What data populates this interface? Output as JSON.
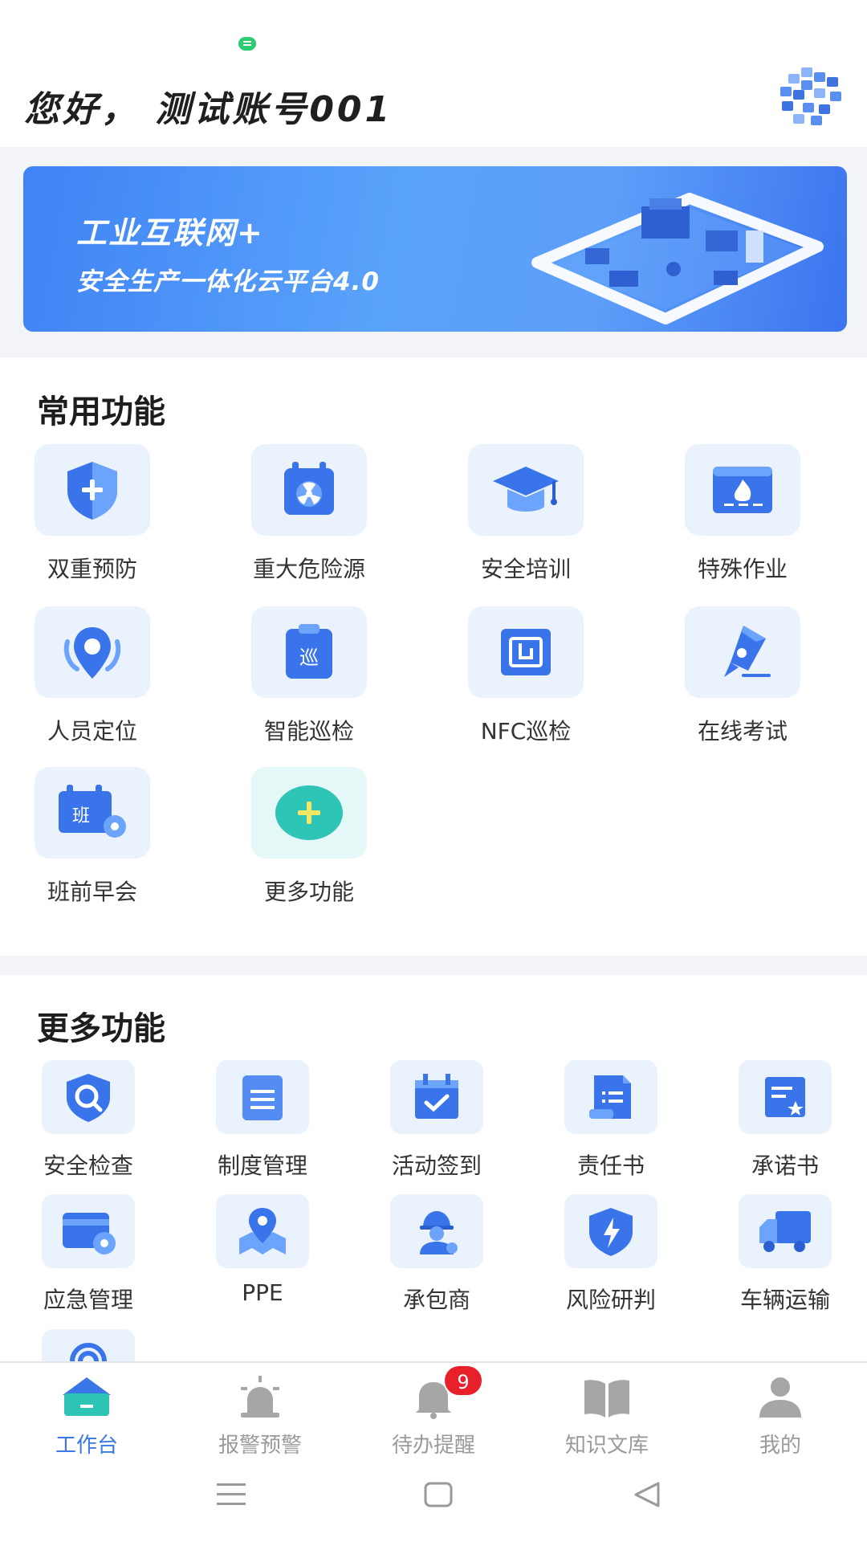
{
  "header": {
    "greeting": "您好， 测试账号001"
  },
  "banner": {
    "line1": "工业互联网+",
    "line2": "安全生产一体化云平台4.0"
  },
  "common_section": {
    "title": "常用功能",
    "items": [
      {
        "label": "双重预防",
        "icon": "shield-plus-icon"
      },
      {
        "label": "重大危险源",
        "icon": "radiation-calendar-icon"
      },
      {
        "label": "安全培训",
        "icon": "graduation-cap-icon"
      },
      {
        "label": "特殊作业",
        "icon": "fire-monitor-icon"
      },
      {
        "label": "人员定位",
        "icon": "location-pin-icon"
      },
      {
        "label": "智能巡检",
        "icon": "patrol-clipboard-icon",
        "glyph": "巡"
      },
      {
        "label": "NFC巡检",
        "icon": "nfc-icon"
      },
      {
        "label": "在线考试",
        "icon": "pen-nib-icon"
      },
      {
        "label": "班前早会",
        "icon": "shift-calendar-gear-icon",
        "glyph": "班"
      },
      {
        "label": "更多功能",
        "icon": "plus-circle-icon"
      }
    ]
  },
  "more_section": {
    "title": "更多功能",
    "items": [
      {
        "label": "安全检查",
        "icon": "shield-search-icon"
      },
      {
        "label": "制度管理",
        "icon": "document-icon"
      },
      {
        "label": "活动签到",
        "icon": "calendar-check-icon"
      },
      {
        "label": "责任书",
        "icon": "scroll-icon"
      },
      {
        "label": "承诺书",
        "icon": "certificate-icon"
      },
      {
        "label": "应急管理",
        "icon": "card-gear-icon"
      },
      {
        "label": "PPE",
        "icon": "map-pin-icon"
      },
      {
        "label": "承包商",
        "icon": "worker-helmet-icon"
      },
      {
        "label": "风险研判",
        "icon": "shield-lightning-icon"
      },
      {
        "label": "车辆运输",
        "icon": "truck-icon"
      },
      {
        "label": "",
        "icon": "signal-icon"
      }
    ]
  },
  "bottom_nav": {
    "items": [
      {
        "label": "工作台",
        "icon": "workbench-icon",
        "active": true
      },
      {
        "label": "报警预警",
        "icon": "alarm-light-icon"
      },
      {
        "label": "待办提醒",
        "icon": "bell-icon",
        "badge": "9"
      },
      {
        "label": "知识文库",
        "icon": "book-icon"
      },
      {
        "label": "我的",
        "icon": "user-icon"
      }
    ]
  },
  "colors": {
    "accent": "#3b78e7",
    "icon_bg": "#eaf2fd",
    "badge": "#e8202a",
    "banner": "#4a8ff7"
  }
}
